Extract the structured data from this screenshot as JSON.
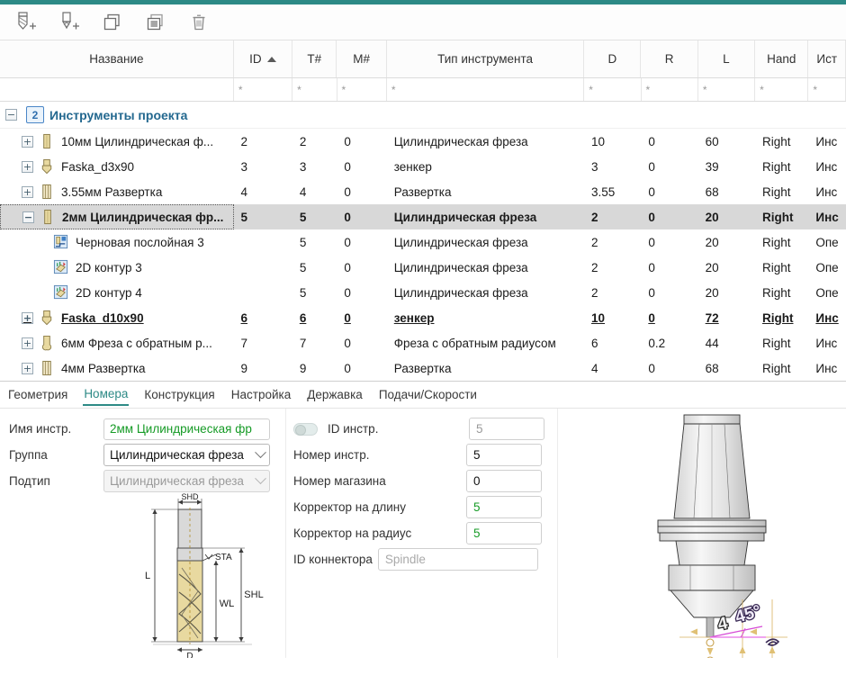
{
  "toolbar": {
    "buttons": [
      {
        "name": "add-mill-tool-button",
        "icon": "end-mill-plus-icon",
        "title": "Добавить фрезу"
      },
      {
        "name": "add-drill-tool-button",
        "icon": "drill-plus-icon",
        "title": "Добавить сверло"
      },
      {
        "name": "copy-button",
        "icon": "copy-icon",
        "title": "Копировать"
      },
      {
        "name": "paste-button",
        "icon": "paste-icon",
        "title": "Вставить"
      },
      {
        "name": "delete-button",
        "icon": "trash-icon",
        "title": "Удалить"
      }
    ]
  },
  "table": {
    "columns": [
      {
        "key": "name",
        "label": "Название",
        "sort": ""
      },
      {
        "key": "id",
        "label": "ID",
        "sort": "asc"
      },
      {
        "key": "t",
        "label": "T#",
        "sort": ""
      },
      {
        "key": "m",
        "label": "M#",
        "sort": ""
      },
      {
        "key": "type",
        "label": "Тип инструмента",
        "sort": ""
      },
      {
        "key": "d",
        "label": "D",
        "sort": ""
      },
      {
        "key": "r",
        "label": "R",
        "sort": ""
      },
      {
        "key": "l",
        "label": "L",
        "sort": ""
      },
      {
        "key": "hand",
        "label": "Hand",
        "sort": ""
      },
      {
        "key": "src",
        "label": "Ист",
        "sort": ""
      }
    ],
    "filter_placeholder": "*",
    "group": {
      "label": "Инструменты проекта",
      "badge": "2",
      "expander": "−"
    },
    "rows": [
      {
        "indent": 1,
        "expander": "+",
        "icon": "endmill-icon",
        "name": "10мм Цилиндрическая ф...",
        "id": "2",
        "t": "2",
        "m": "0",
        "type": "Цилиндрическая фреза",
        "d": "10",
        "r": "0",
        "l": "60",
        "hand": "Right",
        "src": "Инс",
        "state": ""
      },
      {
        "indent": 1,
        "expander": "+",
        "icon": "countersink-icon",
        "name": "Faska_d3x90",
        "id": "3",
        "t": "3",
        "m": "0",
        "type": "зенкер",
        "d": "3",
        "r": "0",
        "l": "39",
        "hand": "Right",
        "src": "Инс",
        "state": ""
      },
      {
        "indent": 1,
        "expander": "+",
        "icon": "reamer-icon",
        "name": "3.55мм Развертка",
        "id": "4",
        "t": "4",
        "m": "0",
        "type": "Развертка",
        "d": "3.55",
        "r": "0",
        "l": "68",
        "hand": "Right",
        "src": "Инс",
        "state": ""
      },
      {
        "indent": 1,
        "expander": "−",
        "icon": "endmill-icon",
        "name": "2мм Цилиндрическая фр...",
        "id": "5",
        "t": "5",
        "m": "0",
        "type": "Цилиндрическая фреза",
        "d": "2",
        "r": "0",
        "l": "20",
        "hand": "Right",
        "src": "Инс",
        "state": "selected"
      },
      {
        "indent": 2,
        "expander": "",
        "icon": "roughing-op-icon",
        "name": "Черновая послойная 3",
        "id": "",
        "t": "5",
        "m": "0",
        "type": "Цилиндрическая фреза",
        "d": "2",
        "r": "0",
        "l": "20",
        "hand": "Right",
        "src": "Опе",
        "state": ""
      },
      {
        "indent": 2,
        "expander": "",
        "icon": "contour-op-icon",
        "name": "2D контур 3",
        "id": "",
        "t": "5",
        "m": "0",
        "type": "Цилиндрическая фреза",
        "d": "2",
        "r": "0",
        "l": "20",
        "hand": "Right",
        "src": "Опе",
        "state": ""
      },
      {
        "indent": 2,
        "expander": "",
        "icon": "contour-op-icon",
        "name": "2D контур 4",
        "id": "",
        "t": "5",
        "m": "0",
        "type": "Цилиндрическая фреза",
        "d": "2",
        "r": "0",
        "l": "20",
        "hand": "Right",
        "src": "Опе",
        "state": ""
      },
      {
        "indent": 1,
        "expander": "+",
        "icon": "countersink-icon",
        "name": "Faska_d10x90",
        "id": "6",
        "t": "6",
        "m": "0",
        "type": "зенкер",
        "d": "10",
        "r": "0",
        "l": "72",
        "hand": "Right",
        "src": "Инс",
        "state": "hovered"
      },
      {
        "indent": 1,
        "expander": "+",
        "icon": "backradius-icon",
        "name": "6мм Фреза с обратным р...",
        "id": "7",
        "t": "7",
        "m": "0",
        "type": "Фреза с обратным радиусом",
        "d": "6",
        "r": "0.2",
        "l": "44",
        "hand": "Right",
        "src": "Инс",
        "state": ""
      },
      {
        "indent": 1,
        "expander": "+",
        "icon": "reamer-icon",
        "name": "4мм Развертка",
        "id": "9",
        "t": "9",
        "m": "0",
        "type": "Развертка",
        "d": "4",
        "r": "0",
        "l": "68",
        "hand": "Right",
        "src": "Инс",
        "state": ""
      }
    ]
  },
  "tabs": [
    {
      "label": "Геометрия",
      "active": false
    },
    {
      "label": "Номера",
      "active": true
    },
    {
      "label": "Конструкция",
      "active": false
    },
    {
      "label": "Настройка",
      "active": false
    },
    {
      "label": "Державка",
      "active": false
    },
    {
      "label": "Подачи/Скорости",
      "active": false
    }
  ],
  "form": {
    "tool_name": {
      "label": "Имя инстр.",
      "value": "2мм Цилиндрическая фр"
    },
    "group": {
      "label": "Группа",
      "value": "Цилиндрическая фреза"
    },
    "subtype": {
      "label": "Подтип",
      "value": "Цилиндрическая фреза"
    },
    "tool_id": {
      "label": "ID инстр.",
      "value": "5",
      "toggle": "off"
    },
    "tool_number": {
      "label": "Номер инстр.",
      "value": "5"
    },
    "magazine_number": {
      "label": "Номер магазина",
      "value": "0"
    },
    "length_offset": {
      "label": "Корректор на длину",
      "value": "5"
    },
    "radius_offset": {
      "label": "Корректор на радиус",
      "value": "5"
    },
    "connector_id": {
      "label": "ID коннектора",
      "placeholder": "Spindle",
      "value": ""
    }
  },
  "tool_diagram": {
    "labels": {
      "shd": "SHD",
      "sta": "STA",
      "l": "L",
      "wl": "WL",
      "shl": "SHL",
      "d": "D"
    }
  },
  "holder_preview": {
    "annotations": {
      "diameter": "4",
      "angle": "45°"
    }
  },
  "colors": {
    "accent": "#2d8a86",
    "group_title": "#23688f",
    "value_green": "#169b26",
    "selection": "#d8d8d8",
    "flute": "#e8d9a0"
  }
}
